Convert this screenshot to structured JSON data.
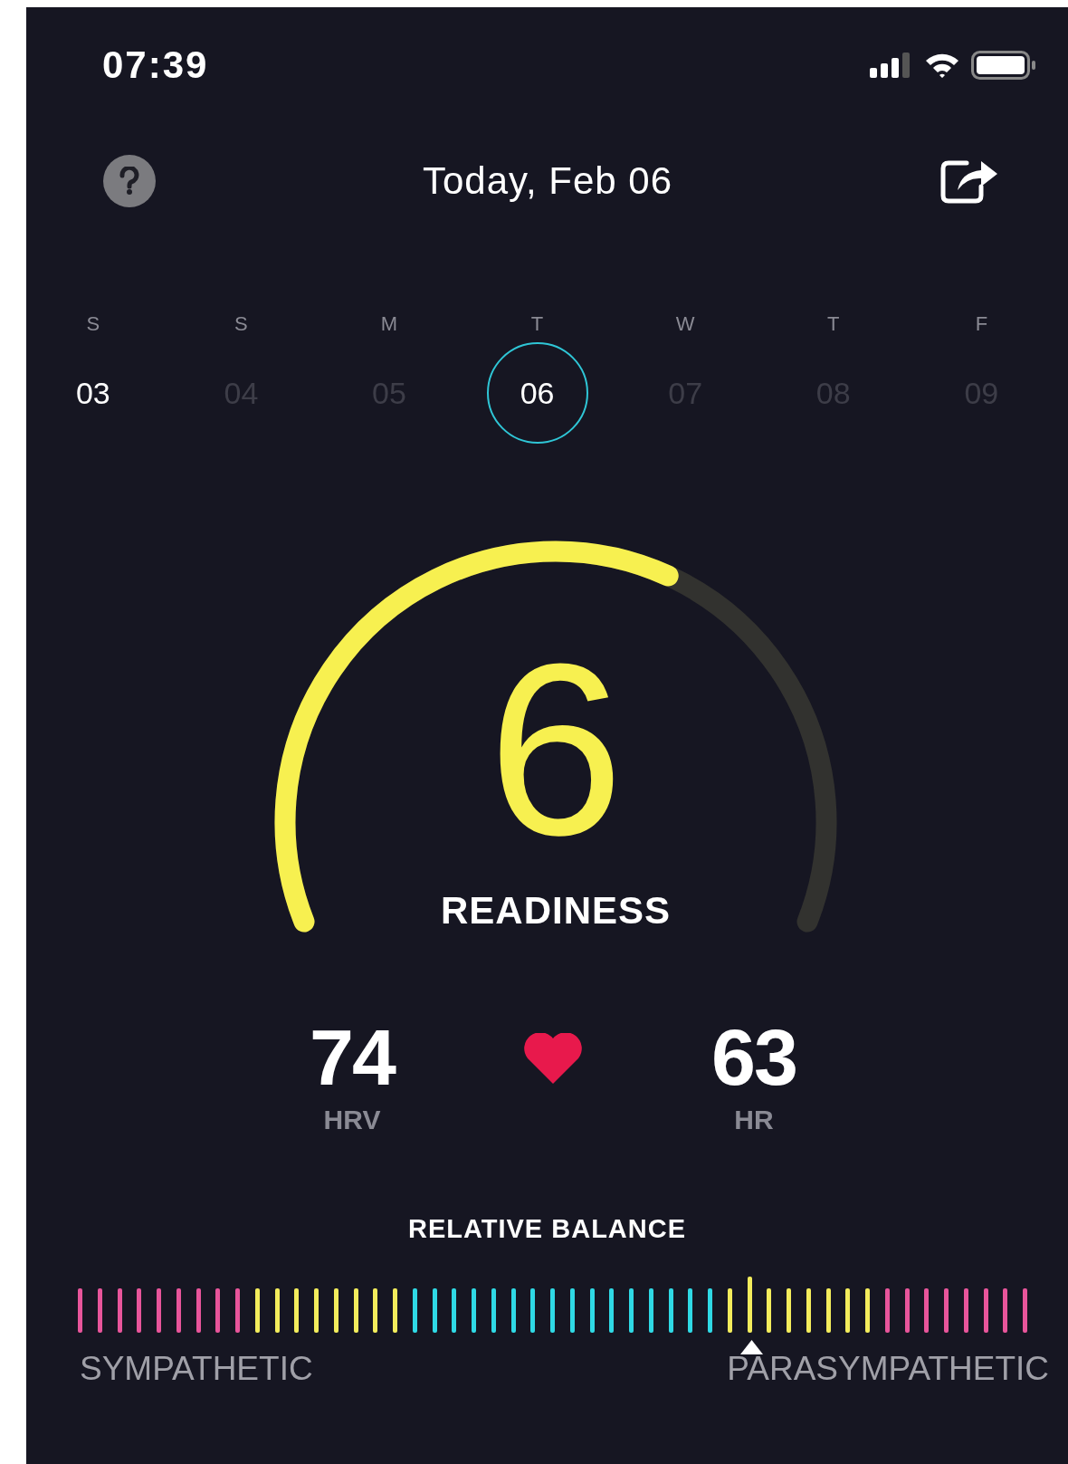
{
  "status_bar": {
    "time": "07:39"
  },
  "header": {
    "title": "Today, Feb 06"
  },
  "week": [
    {
      "weekday": "S",
      "date": "03",
      "selected": false,
      "dimmed": false
    },
    {
      "weekday": "S",
      "date": "04",
      "selected": false,
      "dimmed": true
    },
    {
      "weekday": "M",
      "date": "05",
      "selected": false,
      "dimmed": true
    },
    {
      "weekday": "T",
      "date": "06",
      "selected": true,
      "dimmed": false
    },
    {
      "weekday": "W",
      "date": "07",
      "selected": false,
      "dimmed": true
    },
    {
      "weekday": "T",
      "date": "08",
      "selected": false,
      "dimmed": true
    },
    {
      "weekday": "F",
      "date": "09",
      "selected": false,
      "dimmed": true
    }
  ],
  "readiness": {
    "score": "6",
    "label": "READINESS"
  },
  "vitals": [
    {
      "value": "74",
      "label": "HRV"
    },
    {
      "value": "63",
      "label": "HR"
    }
  ],
  "balance": {
    "title": "RELATIVE BALANCE",
    "left_label": "SYMPATHETIC",
    "right_label": "PARASYMPATHETIC"
  }
}
